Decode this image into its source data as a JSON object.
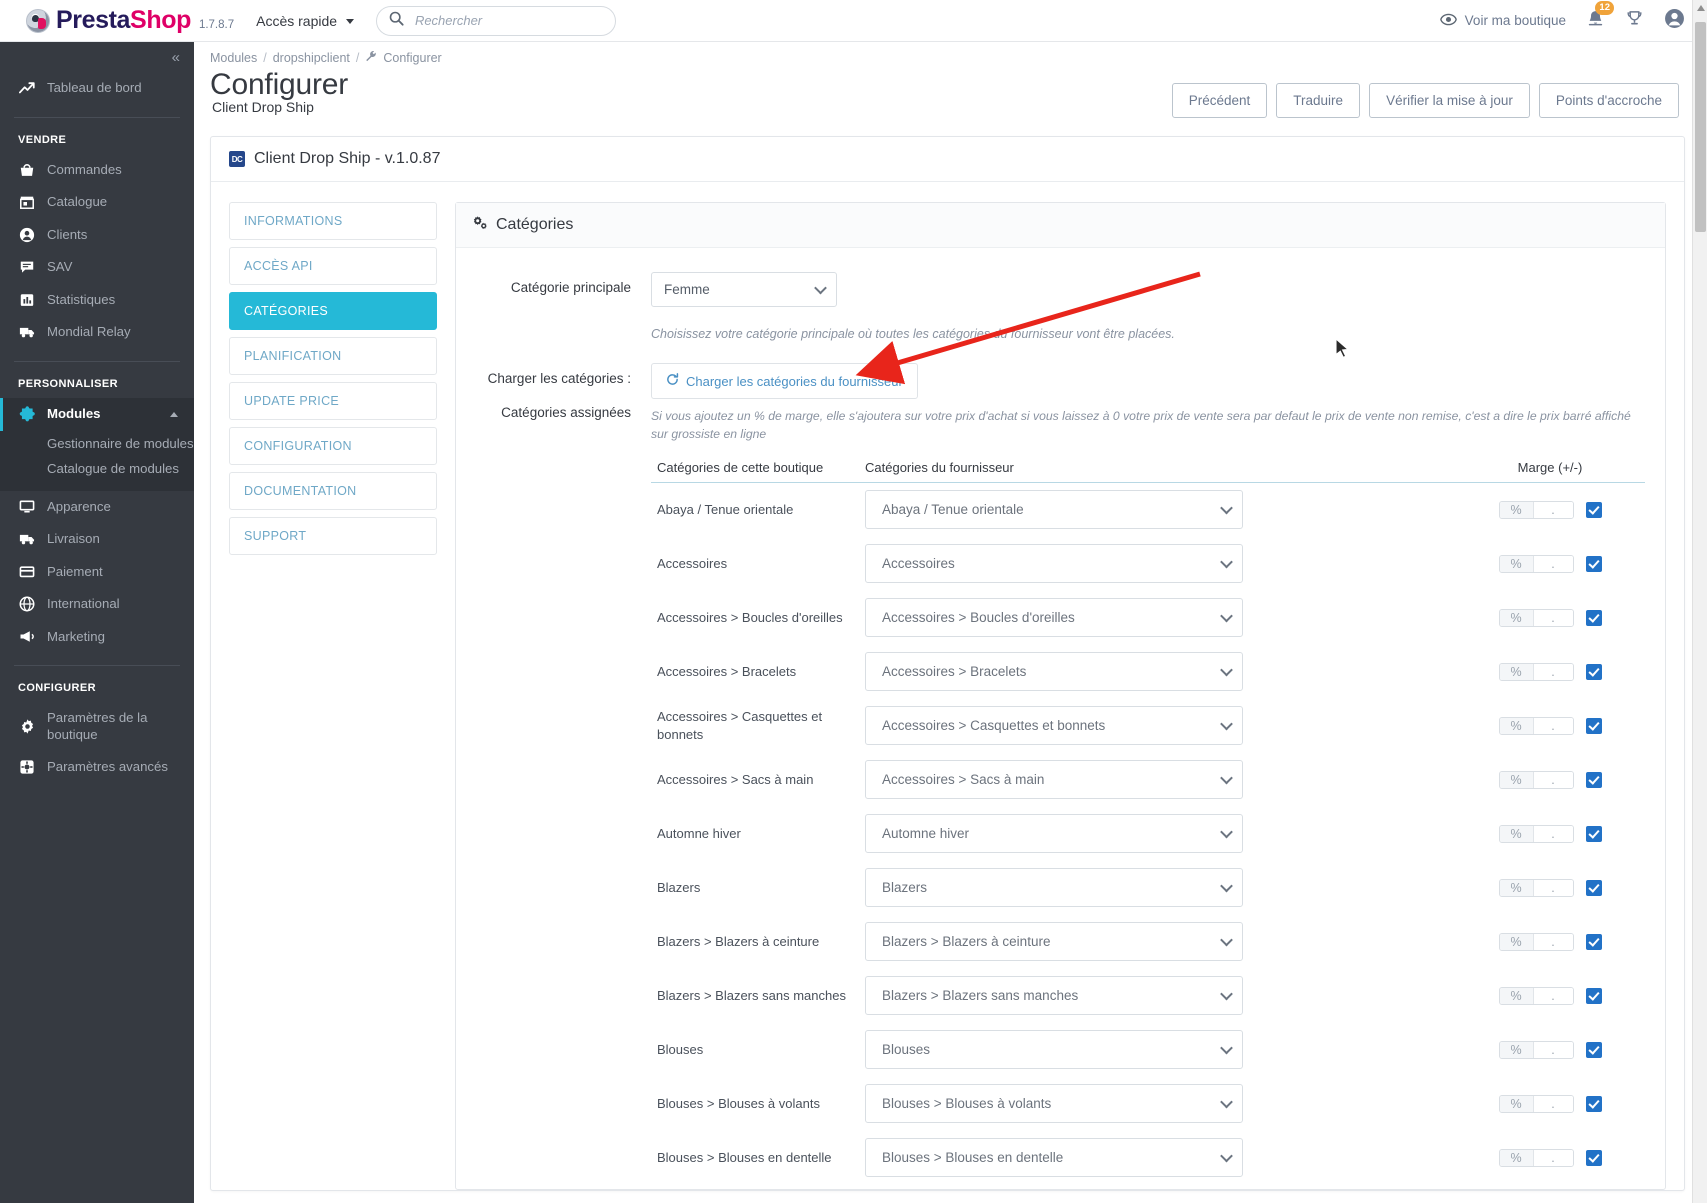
{
  "header": {
    "brand_prefix": "Presta",
    "brand_suffix": "Shop",
    "version": "1.7.8.7",
    "quick_access": "Accès rapide",
    "search_placeholder": "Rechercher",
    "search_value": "",
    "see_shop": "Voir ma boutique",
    "notifications_count": "12",
    "icons": [
      "eye-icon",
      "bell-icon",
      "trophy-icon",
      "account-icon"
    ]
  },
  "sidebar": {
    "collapse_label": "«",
    "dashboard": {
      "label": "Tableau de bord",
      "icon": "trend-up-icon"
    },
    "sections": [
      {
        "title": "VENDRE",
        "items": [
          {
            "label": "Commandes",
            "icon": "basket-icon"
          },
          {
            "label": "Catalogue",
            "icon": "store-icon"
          },
          {
            "label": "Clients",
            "icon": "user-circle-icon"
          },
          {
            "label": "SAV",
            "icon": "chat-icon"
          },
          {
            "label": "Statistiques",
            "icon": "bar-chart-icon"
          },
          {
            "label": "Mondial Relay",
            "icon": "truck-icon"
          }
        ]
      },
      {
        "title": "PERSONNALISER",
        "items": [
          {
            "label": "Modules",
            "icon": "puzzle-icon",
            "active": true,
            "children": [
              "Gestionnaire de modules",
              "Catalogue de modules"
            ]
          },
          {
            "label": "Apparence",
            "icon": "monitor-icon"
          },
          {
            "label": "Livraison",
            "icon": "truck-icon"
          },
          {
            "label": "Paiement",
            "icon": "card-icon"
          },
          {
            "label": "International",
            "icon": "globe-icon"
          },
          {
            "label": "Marketing",
            "icon": "megaphone-icon"
          }
        ]
      },
      {
        "title": "CONFIGURER",
        "items": [
          {
            "label": "Paramètres de la boutique",
            "icon": "gear-icon"
          },
          {
            "label": "Paramètres avancés",
            "icon": "gear-square-icon"
          }
        ]
      }
    ]
  },
  "page": {
    "breadcrumb": [
      "Modules",
      "dropshipclient",
      "Configurer"
    ],
    "title": "Configurer",
    "subtitle": "Client Drop Ship",
    "actions": [
      "Précédent",
      "Traduire",
      "Vérifier la mise à jour",
      "Points d'accroche"
    ]
  },
  "panel": {
    "module_badge": "DC",
    "module_title": "Client Drop Ship - v.1.0.87",
    "tabs": [
      {
        "label": "INFORMATIONS",
        "active": false
      },
      {
        "label": "ACCÈS API",
        "active": false
      },
      {
        "label": "CATÉGORIES",
        "active": true
      },
      {
        "label": "PLANIFICATION",
        "active": false
      },
      {
        "label": "UPDATE PRICE",
        "active": false
      },
      {
        "label": "CONFIGURATION",
        "active": false
      },
      {
        "label": "DOCUMENTATION",
        "active": false
      },
      {
        "label": "SUPPORT",
        "active": false
      }
    ]
  },
  "categories_panel": {
    "card_title": "Catégories",
    "card_icon": "gears-icon",
    "main_category_label": "Catégorie principale",
    "main_category_value": "Femme",
    "main_category_options": [
      "Femme"
    ],
    "main_category_hint": "Choisissez votre catégorie principale où toutes les catégories du fournisseur vont être placées.",
    "load_label": "Charger les catégories :",
    "load_button": "Charger les catégories du fournisseur",
    "load_button_icon": "refresh-icon",
    "assigned_label": "Catégories assignées",
    "assigned_note": "Si vous ajoutez un % de marge, elle s'ajoutera sur votre prix d'achat si vous laissez à 0 votre prix de vente sera par defaut le prix de vente non remise, c'est a dire le prix barré affiché sur grossiste en ligne",
    "columns": {
      "shop": "Catégories de cette boutique",
      "supplier": "Catégories du fournisseur",
      "margin": "Marge (+/-)"
    },
    "margin_addon": "%",
    "margin_value": ".",
    "rows": [
      {
        "shop": "Abaya / Tenue orientale",
        "supplier": "Abaya / Tenue orientale",
        "margin": ".",
        "checked": true
      },
      {
        "shop": "Accessoires",
        "supplier": "Accessoires",
        "margin": ".",
        "checked": true
      },
      {
        "shop": "Accessoires > Boucles d'oreilles",
        "supplier": "Accessoires > Boucles d'oreilles",
        "margin": ".",
        "checked": true
      },
      {
        "shop": "Accessoires > Bracelets",
        "supplier": "Accessoires > Bracelets",
        "margin": ".",
        "checked": true
      },
      {
        "shop": "Accessoires > Casquettes et bonnets",
        "supplier": "Accessoires > Casquettes et bonnets",
        "margin": ".",
        "checked": true
      },
      {
        "shop": "Accessoires > Sacs à main",
        "supplier": "Accessoires > Sacs à main",
        "margin": ".",
        "checked": true
      },
      {
        "shop": "Automne hiver",
        "supplier": "Automne hiver",
        "margin": ".",
        "checked": true
      },
      {
        "shop": "Blazers",
        "supplier": "Blazers",
        "margin": ".",
        "checked": true
      },
      {
        "shop": "Blazers > Blazers à ceinture",
        "supplier": "Blazers > Blazers à ceinture",
        "margin": ".",
        "checked": true
      },
      {
        "shop": "Blazers > Blazers sans manches",
        "supplier": "Blazers > Blazers sans manches",
        "margin": ".",
        "checked": true
      },
      {
        "shop": "Blouses",
        "supplier": "Blouses",
        "margin": ".",
        "checked": true
      },
      {
        "shop": "Blouses > Blouses à volants",
        "supplier": "Blouses > Blouses à volants",
        "margin": ".",
        "checked": true
      },
      {
        "shop": "Blouses > Blouses en dentelle",
        "supplier": "Blouses > Blouses en dentelle",
        "margin": ".",
        "checked": true
      }
    ]
  },
  "annotation": {
    "arrow_color": "#e8251b",
    "arrow_name": "red-pointer-arrow"
  }
}
